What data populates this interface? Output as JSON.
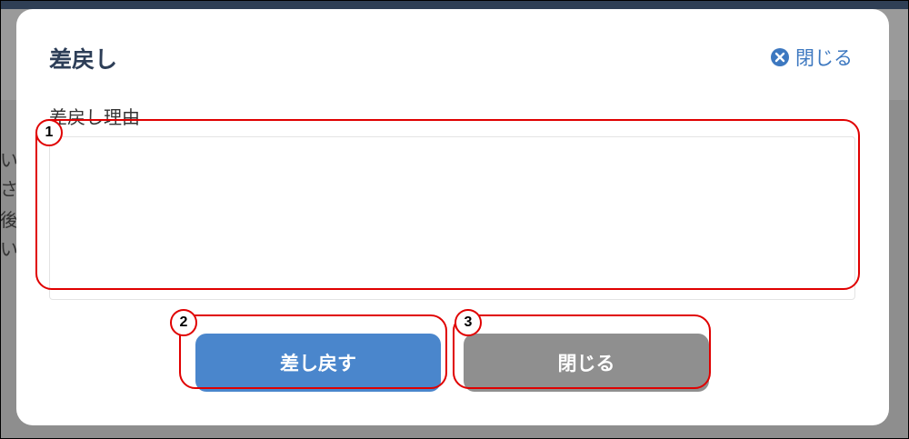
{
  "modal": {
    "title": "差戻し",
    "close_link_label": "閉じる",
    "field_label": "差戻し理由",
    "reason_value": "",
    "submit_label": "差し戻す",
    "close_button_label": "閉じる"
  },
  "background": {
    "text_fragments": [
      "い",
      "さ",
      "後",
      "い"
    ]
  },
  "annotations": {
    "badges": [
      "1",
      "2",
      "3"
    ]
  },
  "colors": {
    "primary": "#4a86cc",
    "secondary": "#8f8f8f",
    "title": "#2d3e57",
    "link": "#3d78c0",
    "annotation": "#e00000"
  }
}
